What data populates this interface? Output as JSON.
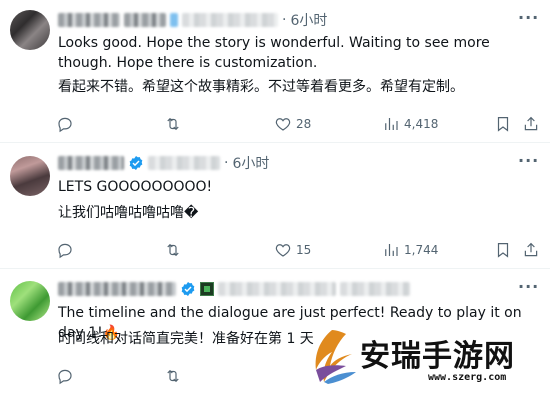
{
  "tweets": [
    {
      "time": "6小时",
      "text_en": "Looks good. Hope the story is wonderful. Waiting to see more though. Hope there is customization.",
      "text_zh": "看起来不错。希望这个故事精彩。不过等着看更多。希望有定制。",
      "replies": "",
      "retweets": "",
      "likes": "28",
      "views": "4,418"
    },
    {
      "time": "6小时",
      "text_en": "LETS GOOOOOOOOO!",
      "text_zh": "让我们咕噜咕噜咕噜�",
      "replies": "",
      "retweets": "",
      "likes": "15",
      "views": "1,744"
    },
    {
      "time": "",
      "text_en": "The timeline and the dialogue are just perfect! Ready to play it on day 1!",
      "fire_emoji": "🔥",
      "text_zh": "时间线和对话简直完美！准备好在第 1 天",
      "replies": "",
      "retweets": "",
      "likes": "",
      "views": ""
    }
  ],
  "separator": "·",
  "more_glyph": "···",
  "watermark": {
    "title": "安瑞手游网",
    "url": "www.szerg.com"
  },
  "colors": {
    "text": "#0f1419",
    "secondary": "#536471",
    "verified": "#1d9bf0",
    "divider": "#eff3f4"
  },
  "icons": [
    "reply-icon",
    "retweet-icon",
    "like-icon",
    "views-icon",
    "bookmark-icon",
    "share-icon",
    "verified-badge-icon",
    "more-icon"
  ]
}
